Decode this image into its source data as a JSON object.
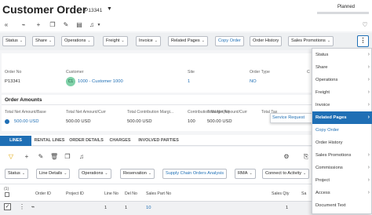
{
  "header": {
    "title": "Customer Order",
    "order_id": "P13341",
    "status": "Planned"
  },
  "toolbar": {
    "buttons": [
      "Status",
      "Share",
      "Operations",
      "Freight",
      "Invoice",
      "Related Pages",
      "Copy Order",
      "Order History",
      "Sales Promotions"
    ]
  },
  "order": {
    "order_no_label": "Order No",
    "order_no": "P13341",
    "customer_label": "Customer",
    "customer_avatar": "C1",
    "customer": "1000 - Customer 1000",
    "site_label": "Site",
    "site": "1",
    "order_type_label": "Order Type",
    "order_type": "NO",
    "extra_label": "C"
  },
  "amounts": {
    "title": "Order Amounts",
    "cols": [
      {
        "label": "Total Net Amount/Base",
        "value": "500.00 USD"
      },
      {
        "label": "Total Net Amount/Curr",
        "value": "500.00 USD"
      },
      {
        "label": "Total Contribution Margi...",
        "value": "500.00 USD"
      },
      {
        "label": "Contribution Margin(%)",
        "value": "100"
      },
      {
        "label": "Total Net Amount/Curr",
        "value": "500.00 USD"
      },
      {
        "label": "Total Tax"
      }
    ],
    "tooltip": "Service Request"
  },
  "tabs": [
    "LINES",
    "RENTAL LINES",
    "ORDER DETAILS",
    "CHARGES",
    "INVOLVED PARTIES"
  ],
  "lines_toolbar": {
    "buttons": [
      "Status",
      "Line Details",
      "Operations",
      "Reservation",
      "Supply Chain Orders Analysis",
      "RMA",
      "Connect to Activity"
    ]
  },
  "table": {
    "headers": [
      "Order ID",
      "Project ID",
      "Line No",
      "Del No",
      "Sales Part No",
      "Sales Qty",
      "Sa"
    ],
    "row": {
      "line_no": "1",
      "del_no": "1",
      "sales_part_no": "10",
      "sales_qty": "1"
    }
  },
  "context_menu": {
    "items": [
      {
        "label": "Status",
        "arrow": "›"
      },
      {
        "label": "Share",
        "arrow": "›"
      },
      {
        "label": "Operations",
        "arrow": "›"
      },
      {
        "label": "Freight",
        "arrow": "›"
      },
      {
        "label": "Invoice",
        "arrow": "›"
      },
      {
        "label": "Related Pages",
        "arrow": "›"
      },
      {
        "label": "Copy Order",
        "arrow": ""
      },
      {
        "label": "Order History",
        "arrow": ""
      },
      {
        "label": "Sales Promotions",
        "arrow": "›"
      },
      {
        "label": "Commissions",
        "arrow": "›"
      },
      {
        "label": "Project",
        "arrow": "›"
      },
      {
        "label": "Access",
        "arrow": "›"
      },
      {
        "label": "Document Text",
        "arrow": ""
      }
    ]
  },
  "colors": {
    "accent": "#1f6fb5",
    "avatar": "#7fd1a8"
  }
}
